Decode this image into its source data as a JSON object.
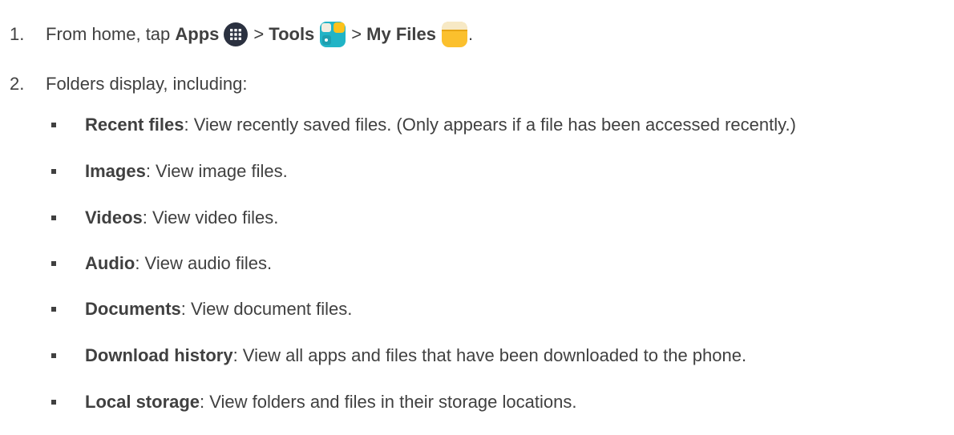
{
  "step1": {
    "number": "1.",
    "intro": "From home, tap",
    "apps_label": "Apps",
    "apps_icon": "apps-grid-icon",
    "sep1": ">",
    "tools_label": "Tools",
    "tools_icon": "tools-folder-icon",
    "sep2": ">",
    "myfiles_label": "My Files",
    "myfiles_icon": "my-files-folder-icon",
    "end": "."
  },
  "step2": {
    "number": "2.",
    "text": "Folders display, including:"
  },
  "folders": [
    {
      "name": "Recent files",
      "desc": ": View recently saved files. (Only appears if a file has been accessed recently.)"
    },
    {
      "name": "Images",
      "desc": ": View image files."
    },
    {
      "name": "Videos",
      "desc": ": View video files."
    },
    {
      "name": "Audio",
      "desc": ": View audio files."
    },
    {
      "name": "Documents",
      "desc": ": View document files."
    },
    {
      "name": "Download history",
      "desc": ": View all apps and files that have been downloaded to the phone."
    },
    {
      "name": "Local storage",
      "desc": ": View folders and files in their storage locations."
    }
  ],
  "colors": {
    "text": "#404040",
    "apps_icon_bg": "#2b3140",
    "tools_icon_teal": "#21b4c6",
    "tools_icon_yellow": "#fcc21b",
    "myfiles_icon_yellow": "#fbc02d"
  }
}
